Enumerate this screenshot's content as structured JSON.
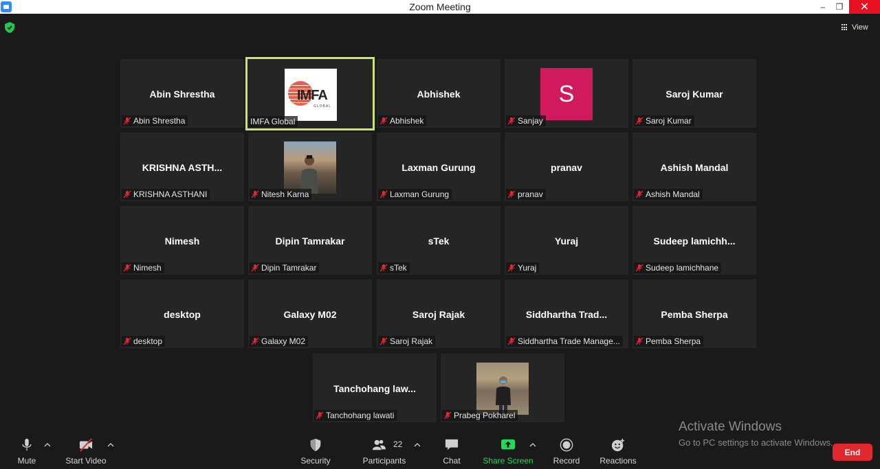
{
  "window": {
    "title": "Zoom Meeting",
    "minimize": "–",
    "maximize": "❐",
    "close": "✕"
  },
  "top": {
    "view_label": "View"
  },
  "tiles": [
    {
      "big": "Abin Shrestha",
      "label": "Abin Shrestha"
    },
    {
      "big": "",
      "label": "IMFA Global"
    },
    {
      "big": "Abhishek",
      "label": "Abhishek"
    },
    {
      "big": "",
      "label": "Sanjay"
    },
    {
      "big": "Saroj Kumar",
      "label": "Saroj Kumar"
    },
    {
      "big": "KRISHNA  ASTH...",
      "label": "KRISHNA ASTHANI"
    },
    {
      "big": "",
      "label": "Nitesh Karna"
    },
    {
      "big": "Laxman Gurung",
      "label": "Laxman Gurung"
    },
    {
      "big": "pranav",
      "label": "pranav"
    },
    {
      "big": "Ashish Mandal",
      "label": "Ashish Mandal"
    },
    {
      "big": "Nimesh",
      "label": "Nimesh"
    },
    {
      "big": "Dipin Tamrakar",
      "label": "Dipin Tamrakar"
    },
    {
      "big": "sTek",
      "label": "sTek"
    },
    {
      "big": "Yuraj",
      "label": "Yuraj"
    },
    {
      "big": "Sudeep  lamichh...",
      "label": "Sudeep lamichhane"
    },
    {
      "big": "desktop",
      "label": "desktop"
    },
    {
      "big": "Galaxy M02",
      "label": "Galaxy M02"
    },
    {
      "big": "Saroj Rajak",
      "label": "Saroj Rajak"
    },
    {
      "big": "Siddhartha  Trad...",
      "label": "Siddhartha Trade Manage..."
    },
    {
      "big": "Pemba Sherpa",
      "label": "Pemba Sherpa"
    },
    {
      "big": "Tanchohang  law...",
      "label": "Tanchohang lawati"
    },
    {
      "big": "",
      "label": "Prabeg Pokharel"
    }
  ],
  "imfa_logo": {
    "text": "IMFA",
    "sub": "GLOBAL"
  },
  "sanjay_avatar": {
    "letter": "S",
    "color": "#d1195e"
  },
  "watermark": {
    "line1": "Activate Windows",
    "line2": "Go to PC settings to activate Windows."
  },
  "toolbar": {
    "mute": "Mute",
    "start_video": "Start Video",
    "security": "Security",
    "participants": "Participants",
    "participants_count": "22",
    "chat": "Chat",
    "share_screen": "Share Screen",
    "record": "Record",
    "reactions": "Reactions",
    "end": "End"
  },
  "colors": {
    "active_speaker": "#c7e86b",
    "share_green": "#23d95a",
    "end_red": "#e0282e",
    "muted_red": "#e0282e"
  }
}
